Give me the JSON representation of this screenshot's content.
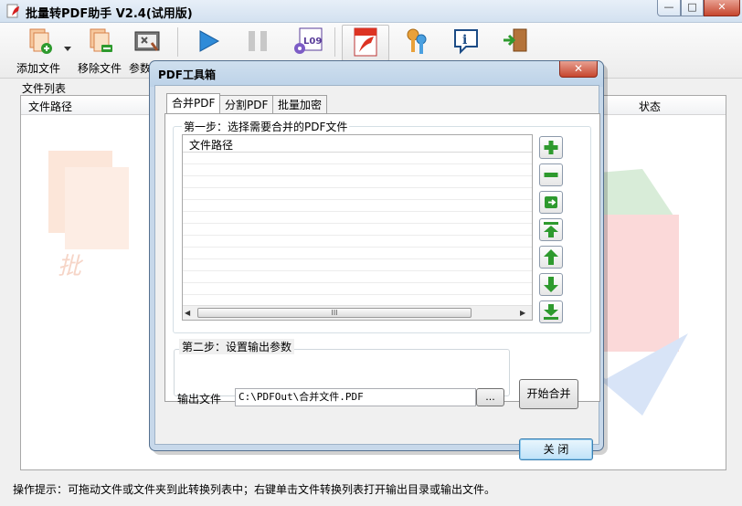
{
  "app": {
    "title": "批量转PDF助手 V2.4(试用版)",
    "caption_buttons": {
      "minimize": "—",
      "maximize": "□",
      "close": "✕"
    }
  },
  "toolbar": {
    "add_file_label": "添加文件",
    "remove_file_label": "移除文件",
    "params_label": "参数",
    "icons": [
      "add-file-icon",
      "dropdown-arrow-icon",
      "remove-file-icon",
      "params-icon",
      "play-icon",
      "pause-icon",
      "log-icon",
      "pdf-toolbox-icon",
      "register-key-icon",
      "about-info-icon",
      "exit-door-icon"
    ]
  },
  "file_list": {
    "title": "文件列表",
    "columns": [
      "文件路径",
      "状态"
    ]
  },
  "hint": "操作提示：可拖动文件或文件夹到此转换列表中；右键单击文件转换列表打开输出目录或输出文件。",
  "dialog": {
    "title": "PDF工具箱",
    "close_glyph": "✕",
    "tabs": [
      "合并PDF",
      "分割PDF",
      "批量加密"
    ],
    "active_tab": 0,
    "step1_label": "第一步：选择需要合并的PDF文件",
    "list_column": "文件路径",
    "side_buttons": [
      "add-icon",
      "remove-icon",
      "clear-icon",
      "move-top-icon",
      "move-up-icon",
      "move-down-icon",
      "move-bottom-icon"
    ],
    "scrollbar": {
      "left": "◀",
      "right": "▶",
      "grip": "III"
    },
    "step2_label": "第二步：设置输出参数",
    "output_label": "输出文件",
    "output_value": "C:\\PDFOut\\合并文件.PDF",
    "browse_label": "...",
    "start_merge_label": "开始合并",
    "close_label": "关  闭"
  },
  "colors": {
    "accent_green": "#2e9a2e",
    "dialog_frame": "#bcd2e8",
    "close_red": "#c6462e"
  }
}
